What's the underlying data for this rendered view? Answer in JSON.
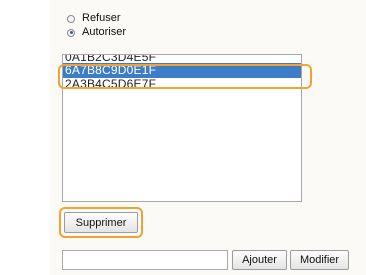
{
  "access": {
    "options": [
      {
        "label": "Refuser",
        "selected": false
      },
      {
        "label": "Autoriser",
        "selected": true
      }
    ]
  },
  "list": {
    "items": [
      "0A1B2C3D4E5F",
      "6A7B8C9D0E1F",
      "2A3B4C5D6E7F"
    ],
    "selected_index": 1
  },
  "buttons": {
    "delete": "Supprimer",
    "add": "Ajouter",
    "edit": "Modifier"
  },
  "input": {
    "value": ""
  },
  "colors": {
    "highlight_ring": "#f0a234",
    "selection": "#3d7cc9"
  }
}
